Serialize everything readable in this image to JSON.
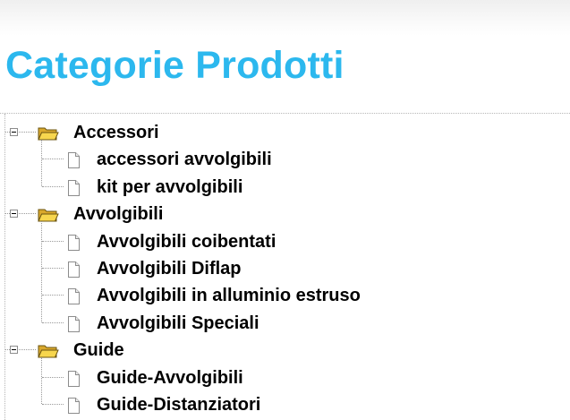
{
  "page": {
    "title": "Categorie Prodotti"
  },
  "icons": {
    "toggle": "collapse-minus-icon",
    "category": "open-folder-icon",
    "item": "document-icon"
  },
  "colors": {
    "title": "#2cb8ee",
    "folder": "#f5d04a",
    "tree_lines": "#9a9a9a"
  },
  "tree": {
    "categories": [
      {
        "label": "Accessori",
        "expanded": true,
        "children": [
          {
            "label": "accessori avvolgibili"
          },
          {
            "label": "kit per avvolgibili"
          }
        ]
      },
      {
        "label": "Avvolgibili",
        "expanded": true,
        "children": [
          {
            "label": "Avvolgibili coibentati"
          },
          {
            "label": "Avvolgibili Diflap"
          },
          {
            "label": "Avvolgibili in alluminio estruso"
          },
          {
            "label": "Avvolgibili Speciali"
          }
        ]
      },
      {
        "label": "Guide",
        "expanded": true,
        "children": [
          {
            "label": "Guide-Avvolgibili"
          },
          {
            "label": "Guide-Distanziatori"
          }
        ]
      }
    ]
  }
}
